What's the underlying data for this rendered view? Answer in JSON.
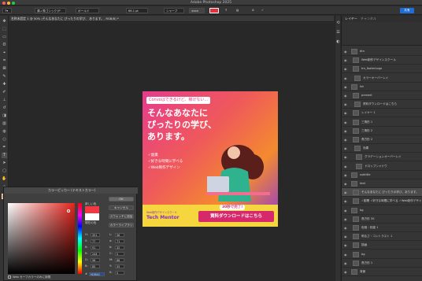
{
  "app_title": "Adobe Photoshop 2025",
  "options": [
    "源ノ角ゴシック JP",
    "ボールド",
    "66.1 pt",
    "シャープ",
    "",
    "",
    "",
    "",
    "",
    "",
    "",
    "",
    "",
    ""
  ],
  "doc_tab": "名称未設定 1 @ 50% (そんなあなたに ぴったりの学び、 あります。, RGB/8) *",
  "banner": {
    "pill": "Convoはできるけど、稼げない…",
    "headline": [
      "そんなあなたに",
      "ぴったりの学び、",
      "あります。"
    ],
    "bullets": [
      "✓副業",
      "✓好きな時間に学べる",
      "✓Web制作デザイン"
    ],
    "brand_sub": "Web制作デザインスクール",
    "brand": "Tech Mentor",
    "cta_tag": "30秒で完了!",
    "cta": "資料ダウンロードはこちら",
    "colors": {
      "pink": "#e63b8c",
      "orange": "#f48a2f",
      "purple": "#8b35d6",
      "yellow": "#f6d63f",
      "cta": "#d6286a"
    }
  },
  "picker": {
    "title": "カラーピッカー (テキストカラー)",
    "ok": "OK",
    "cancel": "キャンセル",
    "add_swatch": "スウォッチに追加",
    "library": "カラーライブラリ",
    "new_label": "新しい色",
    "current_label": "現在の色",
    "web_only": "Web セーフカラーのみに制限",
    "fields": [
      {
        "label": "H:",
        "value": "351"
      },
      {
        "label": "S:",
        "value": "77"
      },
      {
        "label": "B:",
        "value": "91"
      },
      {
        "label": "R:",
        "value": "244"
      },
      {
        "label": "G:",
        "value": "56"
      },
      {
        "label": "B:",
        "value": "85"
      }
    ],
    "lab": [
      {
        "label": "L:",
        "value": "56"
      },
      {
        "label": "a:",
        "value": "71"
      },
      {
        "label": "b:",
        "value": "32"
      },
      {
        "label": "C:",
        "value": "0"
      },
      {
        "label": "M:",
        "value": "88"
      },
      {
        "label": "Y:",
        "value": "55"
      },
      {
        "label": "K:",
        "value": "0"
      }
    ],
    "hex": "f43841"
  },
  "layers": {
    "tabs": [
      "レイヤー",
      "チャンネル"
    ],
    "share": "共有",
    "rows": [
      "btn",
      "Web制作デザインスクール",
      "tm_footerLogo",
      "カラーオーバーレイ",
      "txt",
      "present",
      "資料ダウンロードはこちら",
      "レイヤー 1",
      "三角形 1",
      "三角形 2",
      "長方形 2",
      "効果",
      "グラデーションオーバーレイ",
      "ドロップシャドウ",
      "subtitle",
      "text",
      "そんなあなたに ぴったりの学び、あります。",
      "✓副業 ✓好きな時間に学べる ✓Web制作デザイン",
      "bg",
      "長方形 3S",
      "色相・彩度 1",
      "明るさ・コントラスト 1",
      "描画",
      "bg",
      "長方形 1",
      "背景"
    ]
  }
}
